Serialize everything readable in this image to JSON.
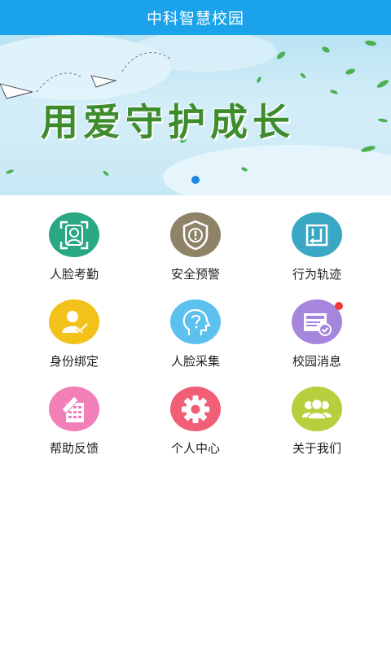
{
  "header": {
    "title": "中科智慧校园"
  },
  "banner": {
    "slogan": "用爱守护成长",
    "active_slide": 1
  },
  "colors": {
    "header_bg": "#1aa3ea",
    "face_attendance": "#2aa783",
    "safety_alert": "#8f8367",
    "behavior_track": "#3aa8c4",
    "identity_bind": "#f2c21a",
    "face_collect": "#5cc1ee",
    "campus_message": "#a685dd",
    "help_feedback": "#f27fb8",
    "personal_center": "#f05f75",
    "about_us": "#b6cf3c"
  },
  "menu": [
    {
      "label": "人脸考勤",
      "icon": "face-frame-icon"
    },
    {
      "label": "安全预警",
      "icon": "shield-alert-icon"
    },
    {
      "label": "行为轨迹",
      "icon": "track-return-icon"
    },
    {
      "label": "身份绑定",
      "icon": "user-check-icon"
    },
    {
      "label": "人脸采集",
      "icon": "head-question-icon"
    },
    {
      "label": "校园消息",
      "icon": "message-check-icon"
    },
    {
      "label": "帮助反馈",
      "icon": "document-pen-icon"
    },
    {
      "label": "个人中心",
      "icon": "gear-icon"
    },
    {
      "label": "关于我们",
      "icon": "group-icon"
    }
  ]
}
